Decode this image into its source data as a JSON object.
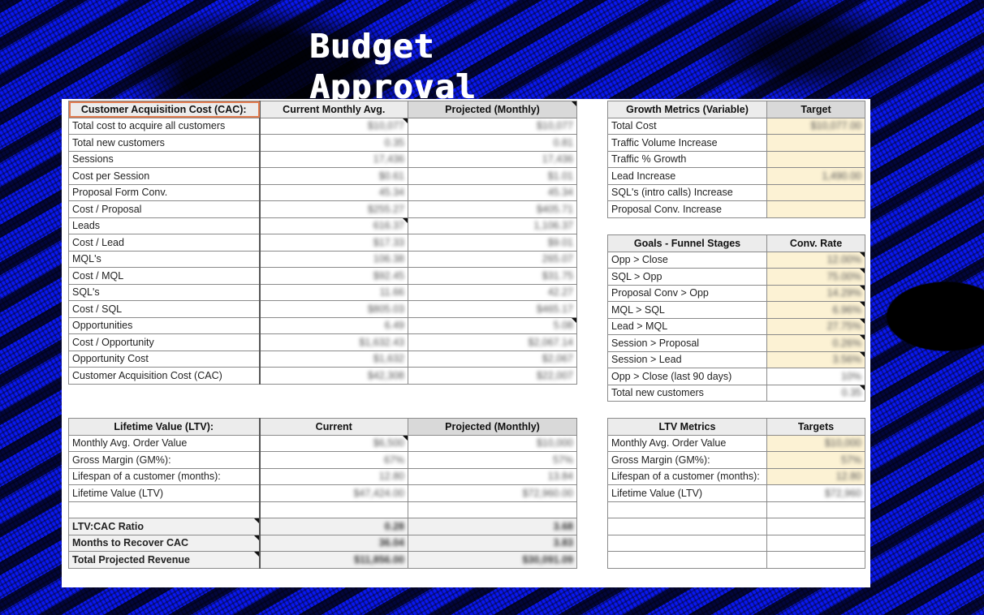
{
  "title": "Budget Approval",
  "cac_table": {
    "headers": [
      "Customer Acquisition Cost (CAC):",
      "Current Monthly Avg.",
      "Projected (Monthly)"
    ],
    "rows": [
      {
        "label": "Total cost to acquire all customers",
        "current": "$10,077",
        "projected": "$10,077"
      },
      {
        "label": "Total new customers",
        "current": "0.35",
        "projected": "0.81"
      },
      {
        "label": "Sessions",
        "current": "17,436",
        "projected": "17,436"
      },
      {
        "label": "Cost per Session",
        "current": "$0.61",
        "projected": "$1.01"
      },
      {
        "label": "Proposal Form Conv.",
        "current": "45.34",
        "projected": "45.34"
      },
      {
        "label": "Cost / Proposal",
        "current": "$255.27",
        "projected": "$405.71"
      },
      {
        "label": "Leads",
        "current": "616.37",
        "projected": "1,106.37"
      },
      {
        "label": "Cost / Lead",
        "current": "$17.33",
        "projected": "$9.01"
      },
      {
        "label": "MQL's",
        "current": "106.38",
        "projected": "265.07"
      },
      {
        "label": "Cost / MQL",
        "current": "$92.45",
        "projected": "$31.75"
      },
      {
        "label": "SQL's",
        "current": "11.66",
        "projected": "42.27"
      },
      {
        "label": "Cost / SQL",
        "current": "$805.03",
        "projected": "$465.17"
      },
      {
        "label": "Opportunities",
        "current": "6.49",
        "projected": "5.08"
      },
      {
        "label": "Cost / Opportunity",
        "current": "$1,632.43",
        "projected": "$2,067.14"
      },
      {
        "label": "Opportunity Cost",
        "current": "$1,632",
        "projected": "$2,067"
      },
      {
        "label": "Customer Acquisition Cost (CAC)",
        "current": "$42,308",
        "projected": "$22,007"
      }
    ]
  },
  "ltv_table": {
    "headers": [
      "Lifetime Value (LTV):",
      "Current",
      "Projected (Monthly)"
    ],
    "rows": [
      {
        "label": "Monthly Avg. Order Value",
        "current": "$6,500",
        "projected": "$10,000"
      },
      {
        "label": "Gross Margin (GM%):",
        "current": "67%",
        "projected": "57%"
      },
      {
        "label": "Lifespan of a customer (months):",
        "current": "12.80",
        "projected": "13.84"
      },
      {
        "label": "Lifetime Value (LTV)",
        "current": "$47,424.00",
        "projected": "$72,960.00"
      }
    ],
    "summary": [
      {
        "label": "LTV:CAC Ratio",
        "current": "0.28",
        "projected": "3.68"
      },
      {
        "label": "Months to Recover CAC",
        "current": "36.04",
        "projected": "3.83"
      },
      {
        "label": "Total Projected Revenue",
        "current": "$11,856.00",
        "projected": "$30,091.09"
      }
    ]
  },
  "growth_table": {
    "headers": [
      "Growth Metrics (Variable)",
      "Target"
    ],
    "rows": [
      {
        "label": "Total Cost",
        "value": "$10,077.00"
      },
      {
        "label": "Traffic Volume Increase",
        "value": ""
      },
      {
        "label": "Traffic % Growth",
        "value": ""
      },
      {
        "label": "Lead Increase",
        "value": "1,490.00"
      },
      {
        "label": "SQL's (intro calls) Increase",
        "value": ""
      },
      {
        "label": "Proposal Conv. Increase",
        "value": ""
      }
    ]
  },
  "funnel_table": {
    "headers": [
      "Goals - Funnel Stages",
      "Conv. Rate"
    ],
    "rows": [
      {
        "label": "Opp > Close",
        "value": "12.00%",
        "highlight": true
      },
      {
        "label": "SQL > Opp",
        "value": "75.00%",
        "highlight": true
      },
      {
        "label": "Proposal Conv > Opp",
        "value": "14.29%",
        "highlight": true
      },
      {
        "label": "MQL > SQL",
        "value": "6.96%",
        "highlight": true
      },
      {
        "label": "Lead > MQL",
        "value": "27.75%",
        "highlight": true
      },
      {
        "label": "Session > Proposal",
        "value": "0.26%",
        "highlight": true
      },
      {
        "label": "Session > Lead",
        "value": "3.56%",
        "highlight": true
      },
      {
        "label": "Opp > Close (last 90 days)",
        "value": "10%",
        "highlight": false
      },
      {
        "label": "Total new customers",
        "value": "0.35",
        "highlight": false
      }
    ]
  },
  "ltv_metrics_table": {
    "headers": [
      "LTV Metrics",
      "Targets"
    ],
    "rows": [
      {
        "label": "Monthly Avg. Order Value",
        "value": "$10,000",
        "highlight": true
      },
      {
        "label": "Gross Margin (GM%):",
        "value": "57%",
        "highlight": true
      },
      {
        "label": "Lifespan of a customer (months):",
        "value": "12.80",
        "highlight": true
      },
      {
        "label": "Lifetime Value (LTV)",
        "value": "$72,960",
        "highlight": false
      }
    ]
  },
  "colors": {
    "background_blue": "#0a18f2",
    "highlight_yellow": "#fcf2d4",
    "selected_cell_border": "#e07b4f",
    "header_gray": "#ececec"
  }
}
